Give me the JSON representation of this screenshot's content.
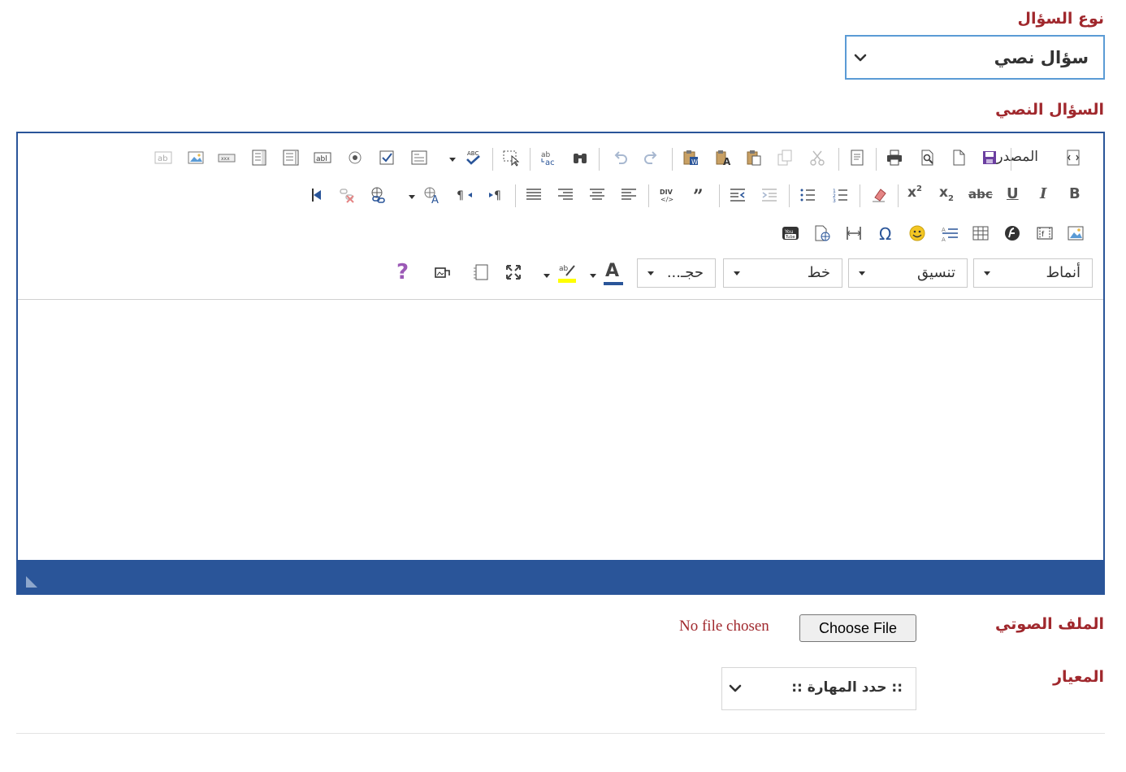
{
  "question_type": {
    "label": "نوع السؤال",
    "selected": "سؤال نصي"
  },
  "text_question": {
    "label": "السؤال النصي"
  },
  "editor": {
    "source_label": "المصدر",
    "combos": {
      "styles": "أنماط",
      "format": "تنسيق",
      "font": "خط",
      "size": "حجـ..."
    },
    "text_buttons": {
      "bold": "B",
      "italic": "I",
      "underline": "U",
      "strike": "abc",
      "subscript": "x",
      "superscript": "x",
      "help": "?",
      "font_color": "A",
      "div": "DIV"
    },
    "toolbar_icons": {
      "row1": [
        "source-icon",
        "save-icon",
        "new-page-icon",
        "preview-icon",
        "print-icon",
        "templates-icon",
        "cut-icon",
        "copy-icon",
        "paste-icon",
        "paste-text-icon",
        "paste-word-icon",
        "redo-icon",
        "undo-icon",
        "find-icon",
        "replace-icon",
        "select-all-icon",
        "spellcheck-icon",
        "form-icon",
        "checkbox-icon",
        "radio-icon",
        "textfield-icon",
        "textarea-icon",
        "select-field-icon",
        "button-field-icon",
        "image-button-icon",
        "hidden-field-icon"
      ],
      "row2": [
        "bold-icon",
        "italic-icon",
        "underline-icon",
        "strike-icon",
        "subscript-icon",
        "superscript-icon",
        "remove-format-icon",
        "numbered-list-icon",
        "bulleted-list-icon",
        "outdent-icon",
        "indent-icon",
        "blockquote-icon",
        "create-div-icon",
        "align-left-icon",
        "align-center-icon",
        "align-right-icon",
        "justify-icon",
        "ltr-icon",
        "rtl-icon",
        "language-icon",
        "link-icon",
        "unlink-icon",
        "anchor-icon"
      ],
      "row3": [
        "image-icon",
        "flash-icon",
        "table-icon",
        "horizontal-rule-icon",
        "smiley-icon",
        "special-char-icon",
        "page-break-icon",
        "iframe-icon",
        "youtube-icon"
      ],
      "row4": [
        "font-color-icon",
        "background-color-icon",
        "maximize-icon",
        "show-blocks-icon",
        "about-icon",
        "help-icon"
      ]
    }
  },
  "audio_file": {
    "label": "الملف الصوتي",
    "button": "Choose File",
    "status": "No file chosen"
  },
  "criterion": {
    "label": "المعيار",
    "placeholder": ":: حدد المهارة ::"
  },
  "colors": {
    "label_red": "#a0282d",
    "editor_blue": "#2a5599",
    "select_border": "#5b9bd5"
  }
}
